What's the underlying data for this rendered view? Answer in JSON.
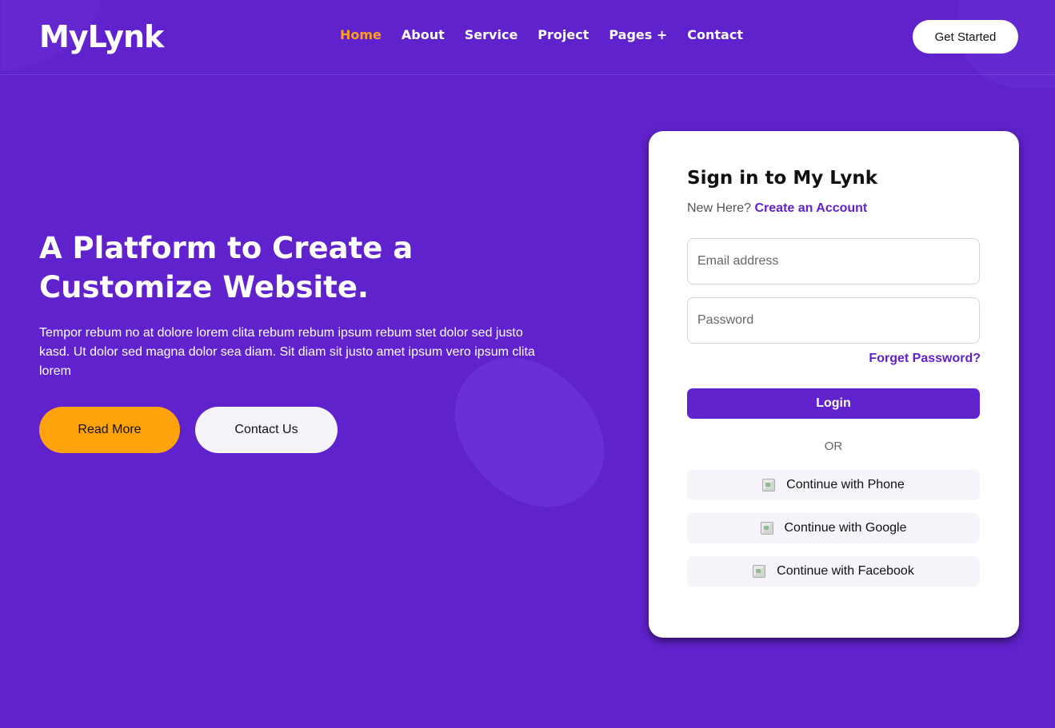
{
  "brand": {
    "logo": "MyLynk"
  },
  "nav": {
    "items": [
      {
        "label": "Home",
        "active": true
      },
      {
        "label": "About",
        "active": false
      },
      {
        "label": "Service",
        "active": false
      },
      {
        "label": "Project",
        "active": false
      },
      {
        "label": "Pages +",
        "active": false
      },
      {
        "label": "Contact",
        "active": false
      }
    ],
    "cta": "Get Started"
  },
  "hero": {
    "title": "A Platform to Create a Customize Website.",
    "text": "Tempor rebum no at dolore lorem clita rebum rebum ipsum rebum stet dolor sed justo kasd. Ut dolor sed magna dolor sea diam. Sit diam sit justo amet ipsum vero ipsum clita lorem",
    "read_more": "Read More",
    "contact_us": "Contact Us"
  },
  "signin": {
    "title": "Sign in to My Lynk",
    "new_here": "New Here?",
    "create_account": "Create an Account",
    "email_placeholder": "Email address",
    "password_placeholder": "Password",
    "forgot": "Forget Password?",
    "login": "Login",
    "or": "OR",
    "phone": "Continue with Phone",
    "google": "Continue with Google",
    "facebook": "Continue with Facebook"
  },
  "colors": {
    "background": "#6022cc",
    "accent": "#fea30b",
    "active_nav": "#ff9f1c"
  }
}
